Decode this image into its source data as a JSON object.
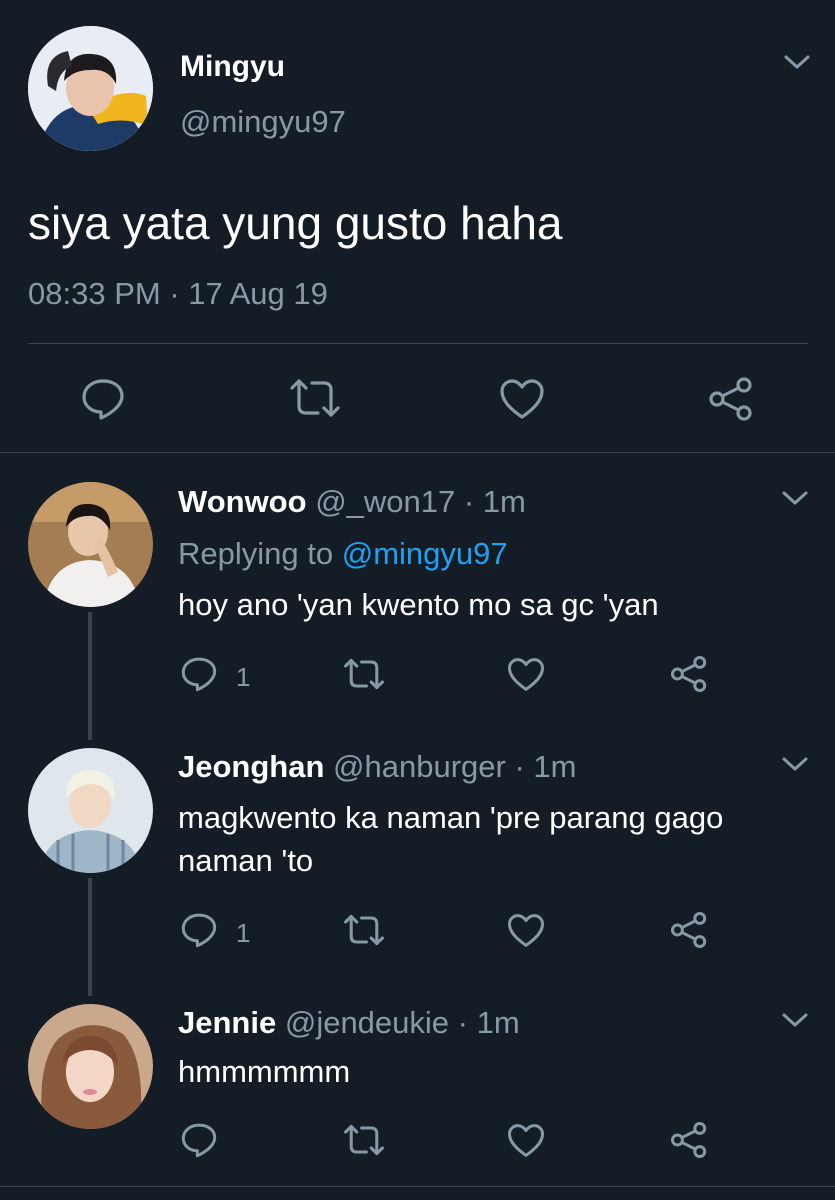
{
  "main_tweet": {
    "display_name": "Mingyu",
    "handle": "@mingyu97",
    "text": "siya yata yung gusto haha",
    "timestamp": "08:33 PM · 17 Aug 19"
  },
  "replies": [
    {
      "display_name": "Wonwoo",
      "handle_time": "@_won17 · 1m",
      "replying_prefix": "Replying to",
      "replying_handle": "@mingyu97",
      "text": "hoy ano 'yan kwento mo sa gc 'yan",
      "reply_count": "1"
    },
    {
      "display_name": "Jeonghan",
      "handle_time": "@hanburger · 1m",
      "text_line1": "magkwento ka naman 'pre parang gago",
      "text_line2": "naman 'to",
      "reply_count": "1"
    },
    {
      "display_name": "Jennie",
      "handle_time": "@jendeukie · 1m",
      "text": "hmmmmmm"
    }
  ],
  "colors": {
    "background": "#141d26",
    "muted_text": "#8899a6",
    "link": "#1da1f2",
    "divider": "#38444d"
  },
  "icons": [
    "reply-icon",
    "retweet-icon",
    "like-icon",
    "share-icon",
    "chevron-down-icon",
    "avatar"
  ]
}
